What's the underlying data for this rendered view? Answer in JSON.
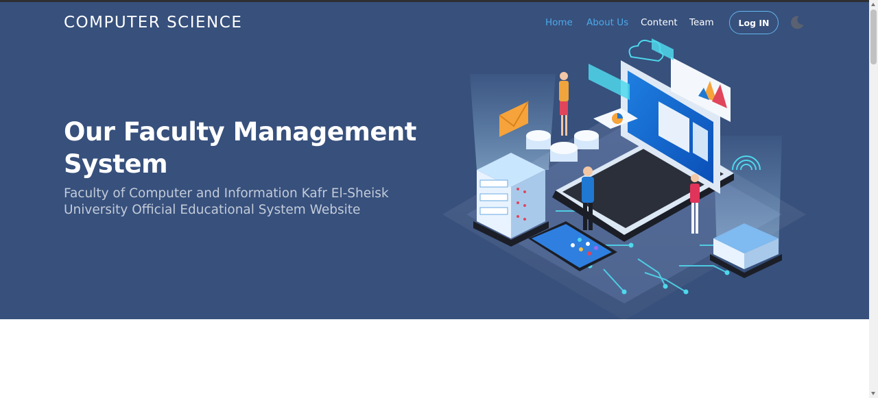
{
  "brand": {
    "title": "COMPUTER SCIENCE"
  },
  "nav": {
    "items": [
      {
        "label": "Home",
        "active": true
      },
      {
        "label": "About Us",
        "active": true
      },
      {
        "label": "Content",
        "active": false
      },
      {
        "label": "Team",
        "active": false
      }
    ],
    "login_label": "Log IN",
    "theme_toggle_icon": "moon-icon"
  },
  "hero": {
    "headline": "Our Faculty Management System",
    "subtitle": "Faculty of Computer and Information Kafr El-Sheisk University Official Educational System Website",
    "illustration": "isometric-computer-system-illustration"
  },
  "colors": {
    "hero_bg": "#37507c",
    "nav_active": "#4da9ea",
    "subtitle": "#c3cbd9",
    "accent_cyan": "#4fd8ec"
  }
}
